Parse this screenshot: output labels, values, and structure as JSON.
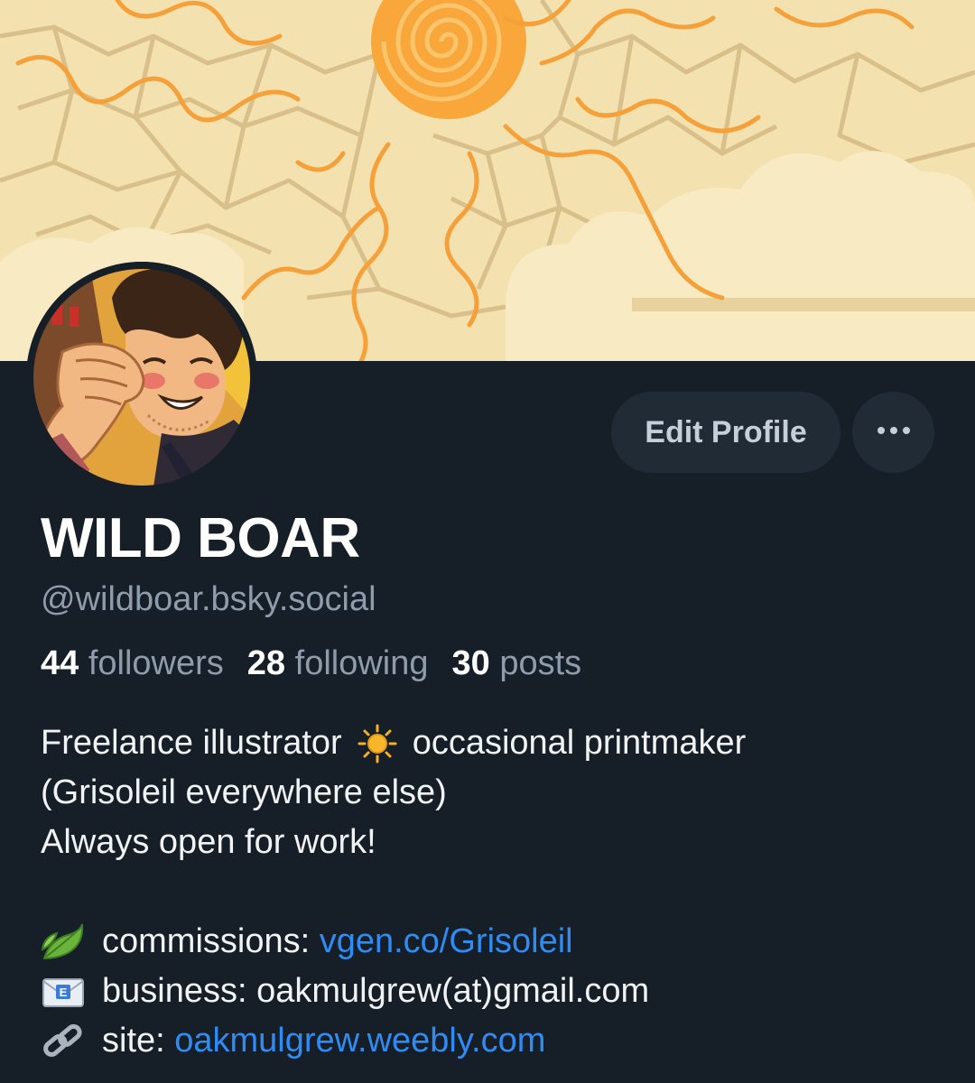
{
  "profile": {
    "display_name": "WILD BOAR",
    "handle": "@wildboar.bsky.social"
  },
  "actions": {
    "edit_label": "Edit Profile",
    "more_label": "•••"
  },
  "stats": {
    "followers_count": "44",
    "followers_label": "followers",
    "following_count": "28",
    "following_label": "following",
    "posts_count": "30",
    "posts_label": "posts"
  },
  "bio": {
    "line1_a": "Freelance illustrator",
    "line1_b": "occasional printmaker",
    "line2": "(Grisoleil everywhere else)",
    "line3": "Always open for work!",
    "commissions_label": "commissions: ",
    "commissions_link": "vgen.co/Grisoleil",
    "business_text": "business: oakmulgrew(at)gmail.com",
    "site_label": "site: ",
    "site_link": "oakmulgrew.weebly.com"
  },
  "icons": {
    "sun": "sun-icon",
    "leaves": "leaves-icon",
    "email": "email-icon",
    "link": "link-icon",
    "more": "ellipsis-icon"
  },
  "colors": {
    "background": "#161e27",
    "banner": "#f3e2b0",
    "accent_link": "#2f8cf5",
    "muted_text": "#8f9cab",
    "button_bg": "#202b36"
  }
}
